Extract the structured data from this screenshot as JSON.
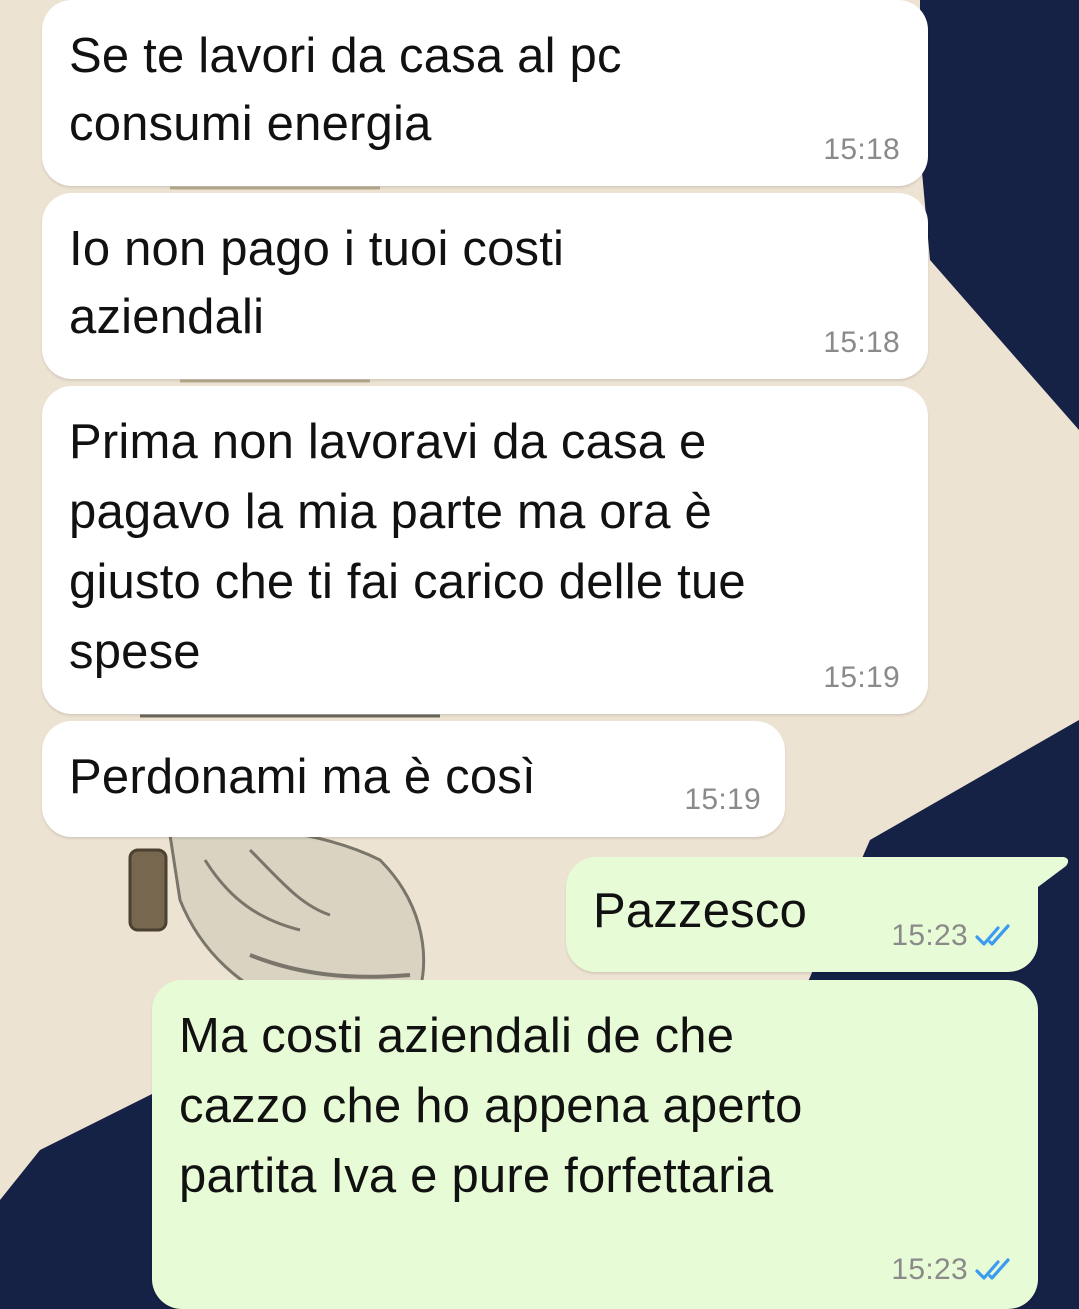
{
  "chat": {
    "messages": [
      {
        "direction": "incoming",
        "lines": [
          "Se te lavori da casa al pc",
          "consumi energia"
        ],
        "time": "15:18"
      },
      {
        "direction": "incoming",
        "lines": [
          "Io non pago i tuoi costi",
          "aziendali"
        ],
        "time": "15:18"
      },
      {
        "direction": "incoming",
        "lines": [
          "Prima non lavoravi da casa e",
          "pagavo la mia parte ma ora è",
          "giusto che ti fai carico delle tue",
          "spese"
        ],
        "time": "15:19"
      },
      {
        "direction": "incoming",
        "lines": [
          "Perdonami ma è così"
        ],
        "time": "15:19"
      },
      {
        "direction": "outgoing",
        "lines": [
          "Pazzesco"
        ],
        "time": "15:23",
        "status": "read",
        "status_icon": "double-check-icon"
      },
      {
        "direction": "outgoing",
        "lines": [
          "Ma costi aziendali de che",
          "cazzo che ho appena aperto",
          "partita Iva e pure forfettaria"
        ],
        "time": "15:23",
        "status": "read",
        "status_icon": "double-check-icon"
      }
    ]
  },
  "colors": {
    "incoming_bubble": "#ffffff",
    "outgoing_bubble": "#e7fbd6",
    "read_tick": "#3b9bf0",
    "timestamp": "#8a8a8a",
    "wallpaper_cream": "#ede3d3",
    "wallpaper_navy": "#152145"
  }
}
